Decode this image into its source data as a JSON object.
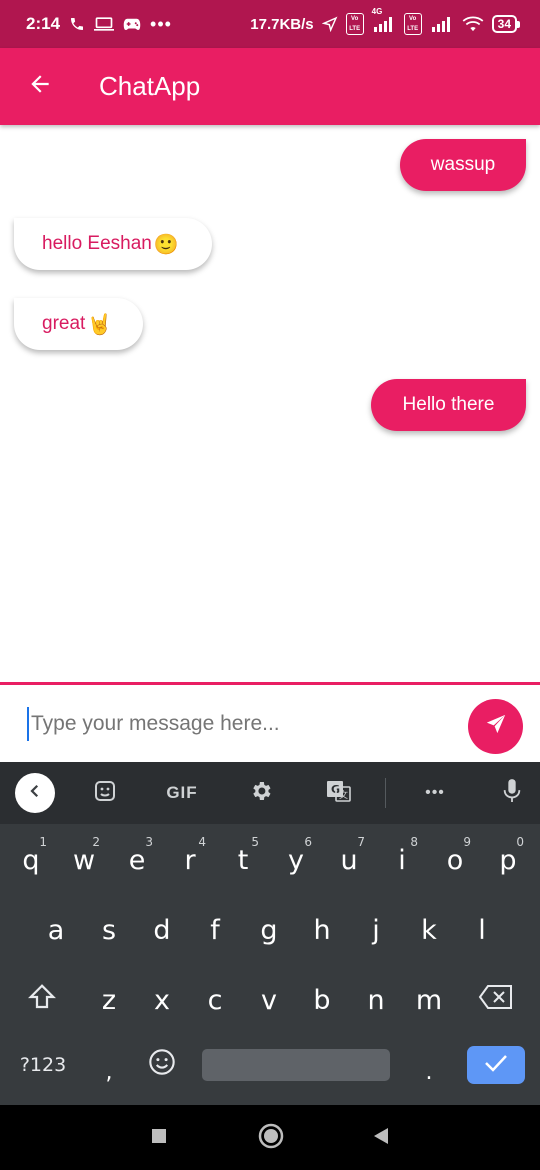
{
  "status_bar": {
    "time": "2:14",
    "net_speed": "17.7KB/s",
    "sim1_tag": "Vo LTE",
    "sim1_network": "4G",
    "sim2_tag": "Vo LTE",
    "battery": "34"
  },
  "app_bar": {
    "title": "ChatApp",
    "back_icon": "arrow-left-icon"
  },
  "messages": [
    {
      "direction": "sent",
      "text": "wassup",
      "emoji": ""
    },
    {
      "direction": "received",
      "text": "hello Eeshan",
      "emoji": "🙂"
    },
    {
      "direction": "received",
      "text": "great",
      "emoji": "🤘"
    },
    {
      "direction": "sent",
      "text": "Hello there",
      "emoji": ""
    }
  ],
  "composer": {
    "placeholder": "Type your message here...",
    "value": "",
    "send_icon": "send-icon"
  },
  "keyboard": {
    "toolbar": {
      "gif_label": "GIF",
      "more_label": "•••"
    },
    "row1": [
      {
        "key": "q",
        "hint": "1"
      },
      {
        "key": "w",
        "hint": "2"
      },
      {
        "key": "e",
        "hint": "3"
      },
      {
        "key": "r",
        "hint": "4"
      },
      {
        "key": "t",
        "hint": "5"
      },
      {
        "key": "y",
        "hint": "6"
      },
      {
        "key": "u",
        "hint": "7"
      },
      {
        "key": "i",
        "hint": "8"
      },
      {
        "key": "o",
        "hint": "9"
      },
      {
        "key": "p",
        "hint": "0"
      }
    ],
    "row2": [
      "a",
      "s",
      "d",
      "f",
      "g",
      "h",
      "j",
      "k",
      "l"
    ],
    "row3": [
      "z",
      "x",
      "c",
      "v",
      "b",
      "n",
      "m"
    ],
    "row4": {
      "symbols_label": "?123",
      "comma_label": ",",
      "period_label": "."
    }
  },
  "colors": {
    "accent": "#e91e63",
    "status_bar": "#b0164f",
    "keyboard_bg": "#373b3e",
    "enter_key": "#5e97f6"
  }
}
